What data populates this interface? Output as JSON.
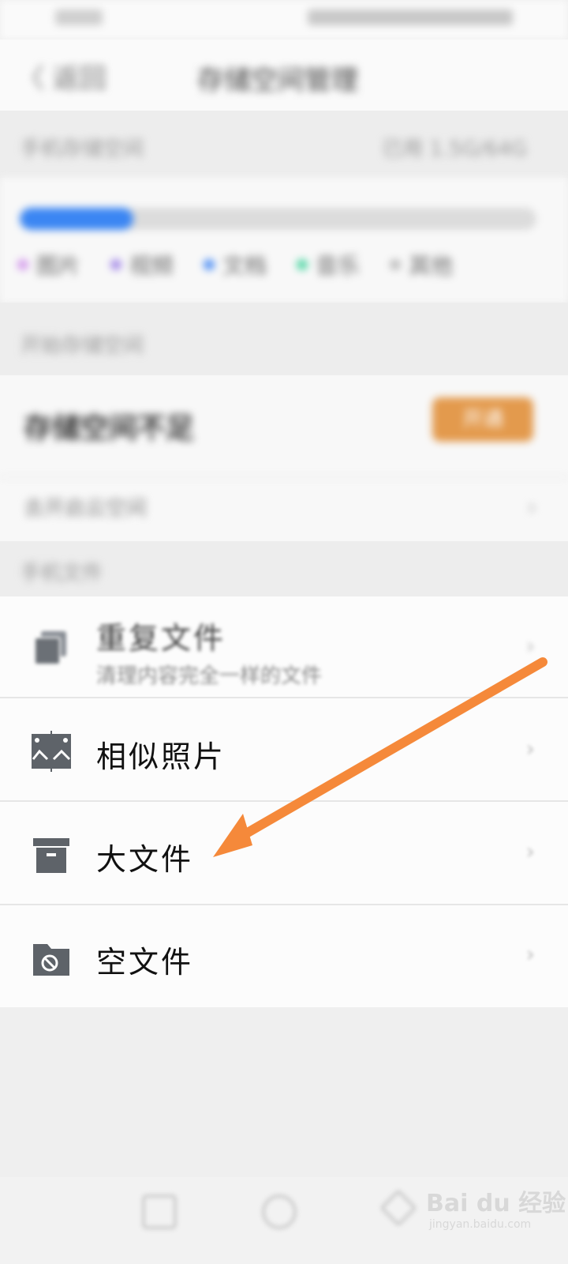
{
  "header": {
    "title": "存储空间管理",
    "back_label": "〈 返回"
  },
  "storage": {
    "section_label": "手机存储空间",
    "used_text": "已用 1.5G/64G",
    "used_fraction": 0.22,
    "legend": [
      {
        "label": "图片",
        "color": "#d49aec"
      },
      {
        "label": "视频",
        "color": "#a58be8"
      },
      {
        "label": "文档",
        "color": "#4f8ff5"
      },
      {
        "label": "音乐",
        "color": "#4fd6a4"
      },
      {
        "label": "其他",
        "color": "#bdbdbd"
      }
    ]
  },
  "suggestion": {
    "section_label": "开始存储空间",
    "text": "存储空间不足",
    "button_label": "开通",
    "sub_label": "去开启云空间"
  },
  "list": {
    "section_label": "手机文件",
    "items": [
      {
        "label": "重复文件",
        "desc": "清理内容完全一样的文件",
        "count": "",
        "icon": "duplicate-files-icon"
      },
      {
        "label": "相似照片",
        "desc": "",
        "count": "",
        "icon": "similar-photos-icon"
      },
      {
        "label": "大文件",
        "desc": "",
        "count": "",
        "icon": "archive-box-icon"
      },
      {
        "label": "空文件",
        "desc": "",
        "count": "",
        "icon": "blocked-folder-icon"
      }
    ]
  },
  "watermark": {
    "main": "Bai du 经验",
    "sub": "jingyan.baidu.com"
  },
  "annotation": {
    "arrow_color": "#f5893a"
  }
}
